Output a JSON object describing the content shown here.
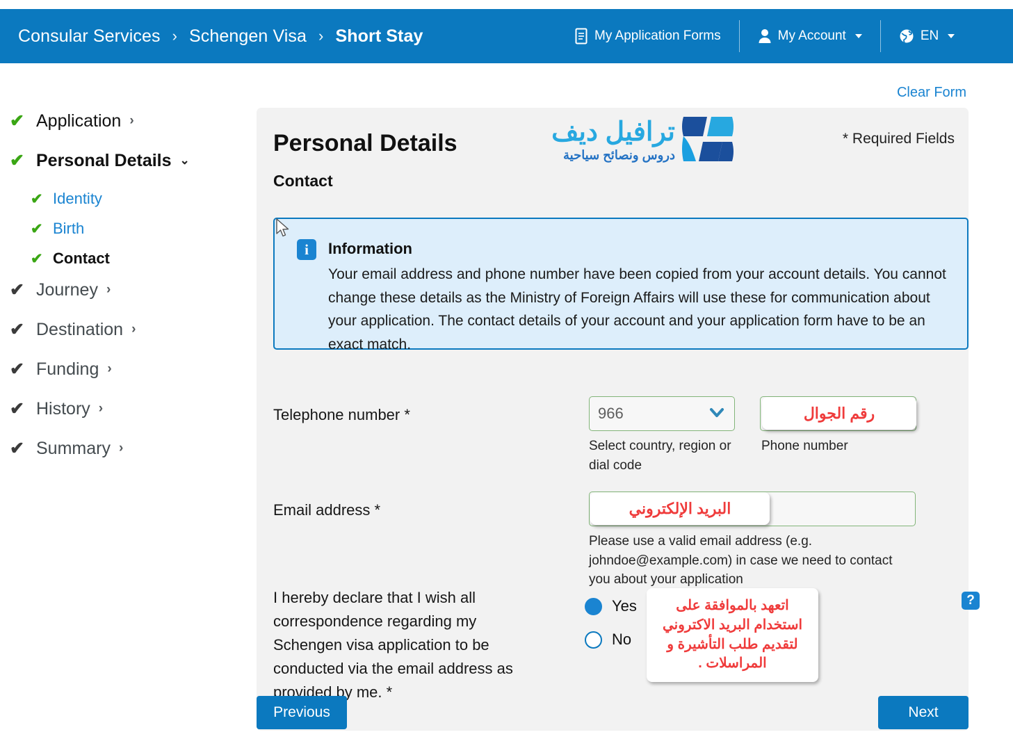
{
  "topbar": {
    "breadcrumb": [
      {
        "label": "Consular Services",
        "active": false
      },
      {
        "label": "Schengen Visa",
        "active": false
      },
      {
        "label": "Short Stay",
        "active": true
      }
    ],
    "separator": "›",
    "nav": {
      "forms_label": "My Application Forms",
      "account_label": "My Account",
      "language_label": "EN"
    },
    "bg_color": "#0b79bf"
  },
  "clear_form_label": "Clear Form",
  "sidebar": {
    "items": [
      {
        "label": "Application",
        "check": "green",
        "arrow": "›",
        "state": "dark"
      },
      {
        "label": "Personal Details",
        "check": "green",
        "arrow": "⌄",
        "state": "bold"
      },
      {
        "label": "Identity",
        "check": "green",
        "arrow": "",
        "state": "link",
        "sub": true
      },
      {
        "label": "Birth",
        "check": "green",
        "arrow": "",
        "state": "link",
        "sub": true
      },
      {
        "label": "Contact",
        "check": "green",
        "arrow": "",
        "state": "subbold",
        "sub": true
      },
      {
        "label": "Journey",
        "check": "grey",
        "arrow": "›",
        "state": "muted"
      },
      {
        "label": "Destination",
        "check": "grey",
        "arrow": "›",
        "state": "muted"
      },
      {
        "label": "Funding",
        "check": "grey",
        "arrow": "›",
        "state": "muted"
      },
      {
        "label": "History",
        "check": "grey",
        "arrow": "›",
        "state": "muted"
      },
      {
        "label": "Summary",
        "check": "grey",
        "arrow": "›",
        "state": "muted"
      }
    ]
  },
  "card": {
    "title": "Personal Details",
    "subtitle": "Contact",
    "required_note": "* Required Fields",
    "logo": {
      "main_text": "ترافيل ديف",
      "tagline": "دروس ونصائح سياحية",
      "primary_color": "#27a8e0",
      "secondary_color": "#1b4f9c"
    },
    "info": {
      "title": "Information",
      "body": "Your email address and phone number have been copied from your account details. You cannot change these details as the Ministry of Foreign Affairs will use these for communication about your application. The contact details of your account and your application form have to be an exact match.",
      "icon": "i",
      "border_color": "#0b79bf",
      "bg_color": "#ddeefb"
    },
    "phone": {
      "label": "Telephone number *",
      "dial_code_value": "966",
      "dial_code_help": "Select country, region or dial code",
      "number_help": "Phone number",
      "number_value": "",
      "annotation": "رقم الجوال"
    },
    "email": {
      "label": "Email address *",
      "value": "",
      "help": "Please use a valid email address (e.g. johndoe@example.com) in case we need to contact you about your application",
      "annotation": "البريد الإلكتروني"
    },
    "declaration": {
      "label": "I hereby declare that I wish all correspondence regarding my Schengen visa application to be conducted via the email address as provided by me. *",
      "option_yes": "Yes",
      "option_no": "No",
      "selected": "Yes",
      "help_icon": "?",
      "annotation": "اتعهد بالموافقة على استخدام البريد الاكتروني لتقديم طلب التأشيرة و المراسلات ."
    },
    "buttons": {
      "previous": "Previous",
      "next": "Next"
    },
    "annotation_color": "#ef3b3b"
  }
}
